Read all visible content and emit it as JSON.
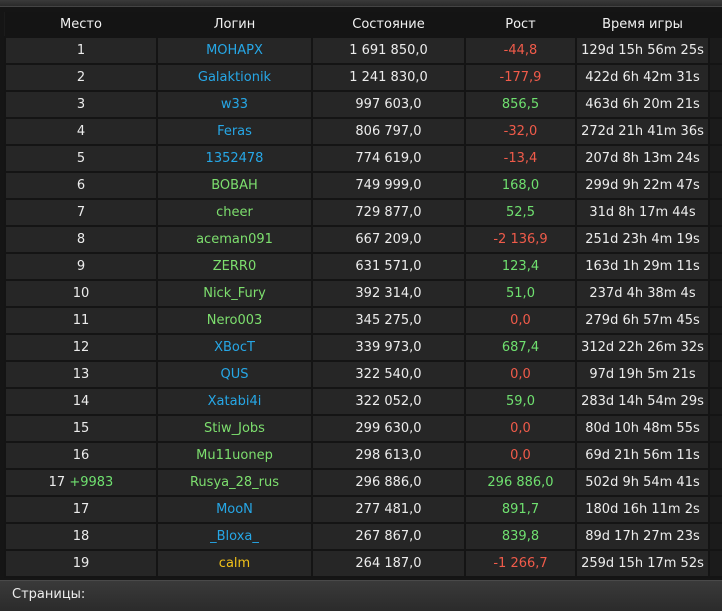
{
  "table": {
    "headers": {
      "place": "Место",
      "login": "Логин",
      "state": "Состояние",
      "growth": "Рост",
      "time": "Время игры"
    },
    "rows": [
      {
        "place": "1",
        "place_bonus": "",
        "login": "MOHAPX",
        "login_color": "blue",
        "state": "1 691 850,0",
        "growth": "-44,8",
        "growth_sign": "neg",
        "time": "129d 15h 56m 25s"
      },
      {
        "place": "2",
        "place_bonus": "",
        "login": "Galaktionik",
        "login_color": "blue",
        "state": "1 241 830,0",
        "growth": "-177,9",
        "growth_sign": "neg",
        "time": "422d 6h 42m 31s"
      },
      {
        "place": "3",
        "place_bonus": "",
        "login": "w33",
        "login_color": "blue",
        "state": "997 603,0",
        "growth": "856,5",
        "growth_sign": "pos",
        "time": "463d 6h 20m 21s"
      },
      {
        "place": "4",
        "place_bonus": "",
        "login": "Feras",
        "login_color": "blue",
        "state": "806 797,0",
        "growth": "-32,0",
        "growth_sign": "neg",
        "time": "272d 21h 41m 36s"
      },
      {
        "place": "5",
        "place_bonus": "",
        "login": "1352478",
        "login_color": "blue",
        "state": "774 619,0",
        "growth": "-13,4",
        "growth_sign": "neg",
        "time": "207d 8h 13m 24s"
      },
      {
        "place": "6",
        "place_bonus": "",
        "login": "BOBAH",
        "login_color": "green",
        "state": "749 999,0",
        "growth": "168,0",
        "growth_sign": "pos",
        "time": "299d 9h 22m 47s"
      },
      {
        "place": "7",
        "place_bonus": "",
        "login": "cheer",
        "login_color": "green",
        "state": "729 877,0",
        "growth": "52,5",
        "growth_sign": "pos",
        "time": "31d 8h 17m 44s"
      },
      {
        "place": "8",
        "place_bonus": "",
        "login": "aceman091",
        "login_color": "green",
        "state": "667 209,0",
        "growth": "-2 136,9",
        "growth_sign": "neg",
        "time": "251d 23h 4m 19s"
      },
      {
        "place": "9",
        "place_bonus": "",
        "login": "ZERR0",
        "login_color": "green",
        "state": "631 571,0",
        "growth": "123,4",
        "growth_sign": "pos",
        "time": "163d 1h 29m 11s"
      },
      {
        "place": "10",
        "place_bonus": "",
        "login": "Nick_Fury",
        "login_color": "green",
        "state": "392 314,0",
        "growth": "51,0",
        "growth_sign": "pos",
        "time": "237d 4h 38m 4s"
      },
      {
        "place": "11",
        "place_bonus": "",
        "login": "Nero003",
        "login_color": "green",
        "state": "345 275,0",
        "growth": "0,0",
        "growth_sign": "zero",
        "time": "279d 6h 57m 45s"
      },
      {
        "place": "12",
        "place_bonus": "",
        "login": "XBocT",
        "login_color": "blue",
        "state": "339 973,0",
        "growth": "687,4",
        "growth_sign": "pos",
        "time": "312d 22h 26m 32s"
      },
      {
        "place": "13",
        "place_bonus": "",
        "login": "QUS",
        "login_color": "blue",
        "state": "322 540,0",
        "growth": "0,0",
        "growth_sign": "zero",
        "time": "97d 19h 5m 21s"
      },
      {
        "place": "14",
        "place_bonus": "",
        "login": "Xatabi4i",
        "login_color": "blue",
        "state": "322 052,0",
        "growth": "59,0",
        "growth_sign": "pos",
        "time": "283d 14h 54m 29s"
      },
      {
        "place": "15",
        "place_bonus": "",
        "login": "Stiw_Jobs",
        "login_color": "green",
        "state": "299 630,0",
        "growth": "0,0",
        "growth_sign": "zero",
        "time": "80d 10h 48m 55s"
      },
      {
        "place": "16",
        "place_bonus": "",
        "login": "Mu11uonep",
        "login_color": "green",
        "state": "298 613,0",
        "growth": "0,0",
        "growth_sign": "zero",
        "time": "69d 21h 56m 11s"
      },
      {
        "place": "17",
        "place_bonus": "+9983",
        "login": "Rusya_28_rus",
        "login_color": "green",
        "state": "296 886,0",
        "growth": "296 886,0",
        "growth_sign": "pos",
        "time": "502d 9h 54m 41s"
      },
      {
        "place": "17",
        "place_bonus": "",
        "login": "MooN",
        "login_color": "blue",
        "state": "277 481,0",
        "growth": "891,7",
        "growth_sign": "pos",
        "time": "180d 16h 11m 2s"
      },
      {
        "place": "18",
        "place_bonus": "",
        "login": "_Bloxa_",
        "login_color": "blue",
        "state": "267 867,0",
        "growth": "839,8",
        "growth_sign": "pos",
        "time": "89d 17h 27m 23s"
      },
      {
        "place": "19",
        "place_bonus": "",
        "login": "calm",
        "login_color": "yellow",
        "state": "264 187,0",
        "growth": "-1 266,7",
        "growth_sign": "neg",
        "time": "259d 15h 17m 52s"
      }
    ]
  },
  "pagination": {
    "label": "Страницы:"
  },
  "colors": {
    "login_blue": "#26a7e6",
    "login_green": "#7ddf6e",
    "login_yellow": "#f0c019",
    "growth_positive": "#6fe06f",
    "growth_negative": "#f05b4a"
  }
}
